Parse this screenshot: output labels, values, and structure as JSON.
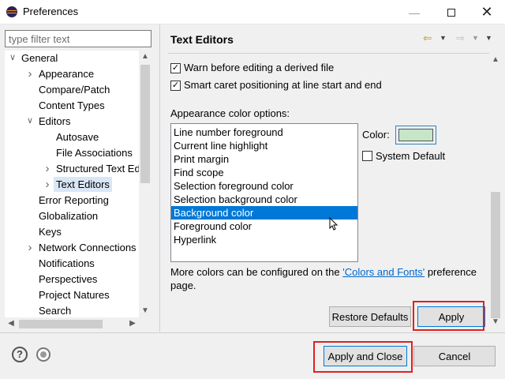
{
  "window": {
    "title": "Preferences"
  },
  "filter": {
    "placeholder": "type filter text",
    "value": ""
  },
  "tree": {
    "items": [
      {
        "label": "General",
        "level": 0,
        "expander": "expanded"
      },
      {
        "label": "Appearance",
        "level": 1,
        "expander": "collapsed"
      },
      {
        "label": "Compare/Patch",
        "level": 1,
        "expander": "none"
      },
      {
        "label": "Content Types",
        "level": 1,
        "expander": "none"
      },
      {
        "label": "Editors",
        "level": 1,
        "expander": "expanded"
      },
      {
        "label": "Autosave",
        "level": 2,
        "expander": "none"
      },
      {
        "label": "File Associations",
        "level": 2,
        "expander": "none"
      },
      {
        "label": "Structured Text Ed",
        "level": 2,
        "expander": "collapsed"
      },
      {
        "label": "Text Editors",
        "level": 2,
        "expander": "collapsed",
        "selected": true
      },
      {
        "label": "Error Reporting",
        "level": 1,
        "expander": "none"
      },
      {
        "label": "Globalization",
        "level": 1,
        "expander": "none"
      },
      {
        "label": "Keys",
        "level": 1,
        "expander": "none"
      },
      {
        "label": "Network Connections",
        "level": 1,
        "expander": "collapsed"
      },
      {
        "label": "Notifications",
        "level": 1,
        "expander": "none"
      },
      {
        "label": "Perspectives",
        "level": 1,
        "expander": "none"
      },
      {
        "label": "Project Natures",
        "level": 1,
        "expander": "none"
      },
      {
        "label": "Search",
        "level": 1,
        "expander": "none"
      }
    ]
  },
  "page": {
    "title": "Text Editors",
    "checkboxes": [
      {
        "label": "Warn before editing a derived file",
        "checked": true
      },
      {
        "label": "Smart caret positioning at line start and end",
        "checked": true
      }
    ],
    "appearance_label": "Appearance color options:",
    "color_options": [
      "Line number foreground",
      "Current line highlight",
      "Print margin",
      "Find scope",
      "Selection foreground color",
      "Selection background color",
      "Background color",
      "Foreground color",
      "Hyperlink"
    ],
    "selected_option": "Background color",
    "color_label": "Color:",
    "color_value": "#c7e6c7",
    "system_default_label": "System Default",
    "system_default_checked": false,
    "more_colors_prefix": "More colors can be configured on the ",
    "more_colors_link": "'Colors and Fonts'",
    "more_colors_suffix": " preference",
    "more_colors_line2": "page.",
    "restore_defaults_label": "Restore Defaults",
    "apply_label": "Apply"
  },
  "footer": {
    "apply_close_label": "Apply and Close",
    "cancel_label": "Cancel"
  },
  "colors": {
    "selection": "#0078d7",
    "highlight_box": "#e02020",
    "link": "#0066cc"
  }
}
